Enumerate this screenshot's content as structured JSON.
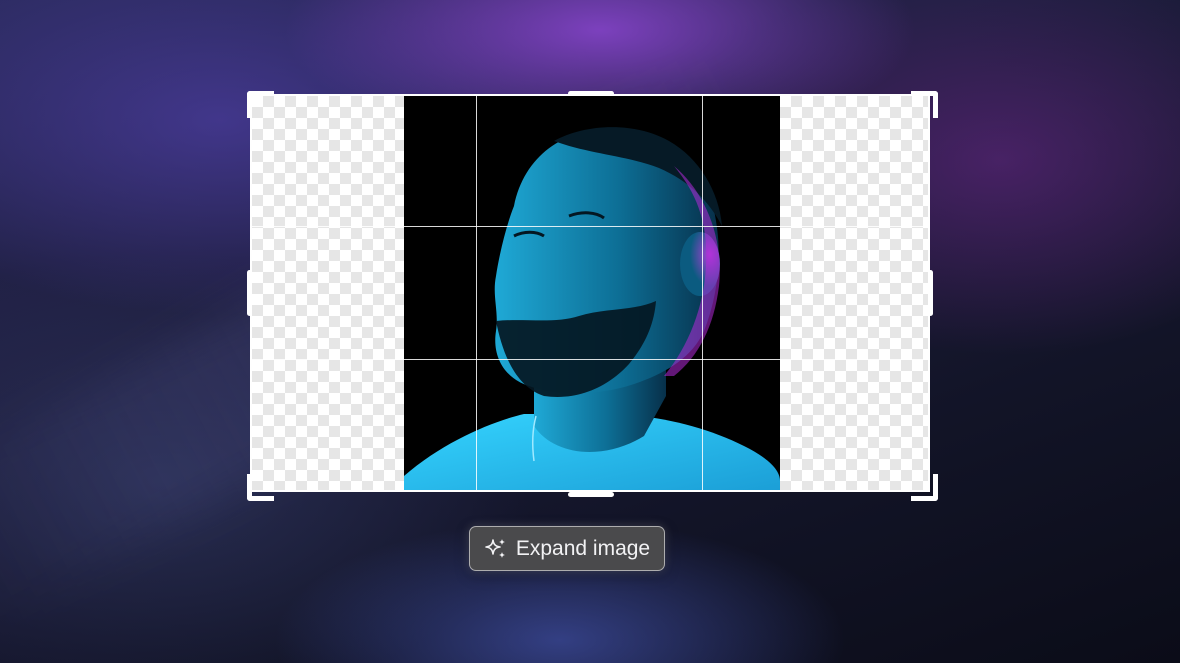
{
  "editor": {
    "action_button": {
      "label": "Expand image",
      "icon": "sparkles-icon"
    }
  },
  "colors": {
    "frame": "#ffffff",
    "button_bg": "#4a4a4c",
    "accent_cyan": "#33c8f0",
    "accent_magenta": "#b32ad8"
  }
}
